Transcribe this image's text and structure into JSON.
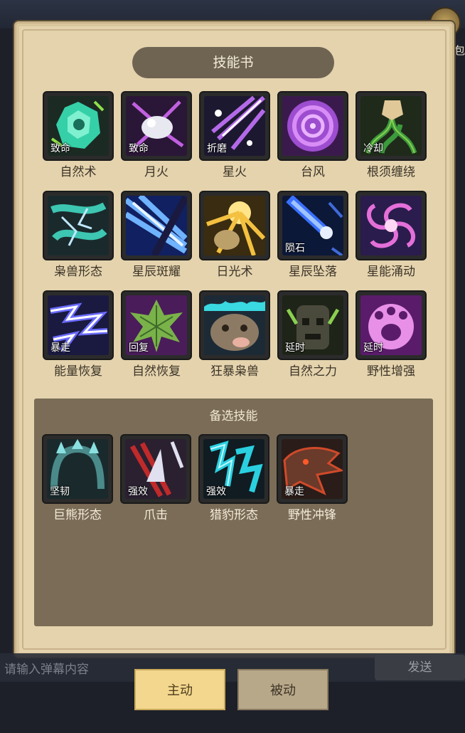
{
  "title": "技能书",
  "corner_label": "包",
  "skills": [
    {
      "name": "自然术",
      "tag": "致命",
      "icon": "nature-orb-icon"
    },
    {
      "name": "月火",
      "tag": "致命",
      "icon": "moonfire-icon"
    },
    {
      "name": "星火",
      "tag": "折磨",
      "icon": "starfire-icon"
    },
    {
      "name": "台风",
      "tag": "",
      "icon": "typhoon-icon"
    },
    {
      "name": "根须缠绕",
      "tag": "冷却",
      "icon": "roots-icon"
    },
    {
      "name": "枭兽形态",
      "tag": "",
      "icon": "moonkin-icon"
    },
    {
      "name": "星辰斑耀",
      "tag": "",
      "icon": "starlight-icon"
    },
    {
      "name": "日光术",
      "tag": "",
      "icon": "sunlight-icon"
    },
    {
      "name": "星辰坠落",
      "tag": "陨石",
      "icon": "starfall-icon"
    },
    {
      "name": "星能涌动",
      "tag": "",
      "icon": "astral-surge-icon"
    },
    {
      "name": "能量恢复",
      "tag": "暴走",
      "icon": "lightning-icon"
    },
    {
      "name": "自然恢复",
      "tag": "回复",
      "icon": "leaf-icon"
    },
    {
      "name": "狂暴枭兽",
      "tag": "",
      "icon": "berserk-owl-icon"
    },
    {
      "name": "自然之力",
      "tag": "延时",
      "icon": "treant-icon"
    },
    {
      "name": "野性增强",
      "tag": "延时",
      "icon": "wild-paw-icon"
    }
  ],
  "alternate": {
    "title": "备选技能",
    "skills": [
      {
        "name": "巨熊形态",
        "tag": "坚韧",
        "icon": "bear-icon"
      },
      {
        "name": "爪击",
        "tag": "强效",
        "icon": "claw-icon"
      },
      {
        "name": "猎豹形态",
        "tag": "强效",
        "icon": "cheetah-icon"
      },
      {
        "name": "野性冲锋",
        "tag": "暴走",
        "icon": "charge-icon"
      }
    ]
  },
  "danmaku": {
    "placeholder": "请输入弹幕内容",
    "send_label": "发送"
  },
  "tabs": [
    {
      "label": "主动",
      "active": true
    },
    {
      "label": "被动",
      "active": false
    }
  ],
  "colors": {
    "panel": "#e4d3ad",
    "title_bar": "#6f6452",
    "alt_box": "#7a6c56",
    "active_tab": "#f3d78e"
  }
}
